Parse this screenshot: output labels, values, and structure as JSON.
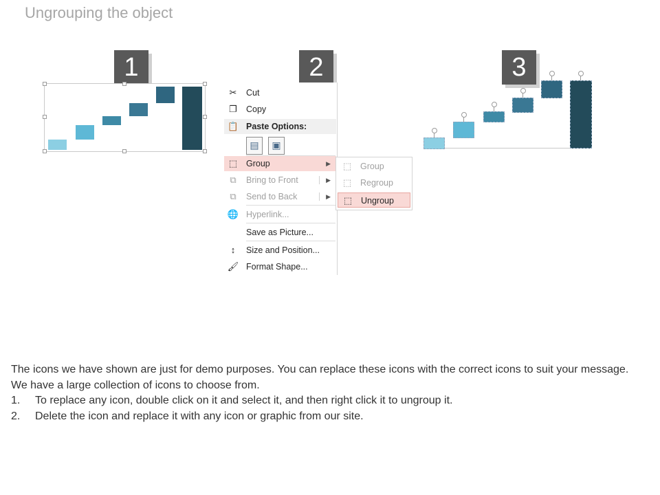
{
  "title": "Ungrouping the object",
  "steps": [
    "1",
    "2",
    "3"
  ],
  "colors": {
    "bar_light": "#8ccfe3",
    "bar_mid": "#5eb8d6",
    "bar_teal": "#3e7f98",
    "bar_dark": "#2c5d72",
    "bar_darkest": "#234b5a",
    "menu_hover": "#f9d9d6"
  },
  "context_menu": {
    "items": [
      {
        "label": "Cut",
        "icon": "scissors-icon",
        "enabled": true
      },
      {
        "label": "Copy",
        "icon": "copy-icon",
        "enabled": true
      },
      {
        "label": "Paste Options:",
        "icon": "paste-icon",
        "header": true
      },
      {
        "label": "Group",
        "icon": "group-icon",
        "enabled": true,
        "submenu": true,
        "highlighted": true
      },
      {
        "label": "Bring to Front",
        "icon": "bring-to-front-icon",
        "enabled": false,
        "submenu": true
      },
      {
        "label": "Send to Back",
        "icon": "send-to-back-icon",
        "enabled": false,
        "submenu": true
      },
      {
        "label": "Hyperlink...",
        "icon": "hyperlink-icon",
        "enabled": false
      },
      {
        "label": "Save as Picture...",
        "icon": "",
        "enabled": true
      },
      {
        "label": "Size and Position...",
        "icon": "size-position-icon",
        "enabled": true
      },
      {
        "label": "Format Shape...",
        "icon": "format-shape-icon",
        "enabled": true
      }
    ]
  },
  "submenu": {
    "items": [
      {
        "label": "Group",
        "icon": "group-icon",
        "enabled": false
      },
      {
        "label": "Regroup",
        "icon": "regroup-icon",
        "enabled": false
      },
      {
        "label": "Ungroup",
        "icon": "ungroup-icon",
        "enabled": true,
        "highlighted": true
      }
    ]
  },
  "body": {
    "intro": "The icons we have shown are just for demo purposes. You can replace these icons with the correct icons to suit your message. We have a large collection of icons to choose from.",
    "list": [
      {
        "num": "1.",
        "text": "To replace any icon, double click on it and select it, and then right click it to ungroup it."
      },
      {
        "num": "2.",
        "text": "Delete the icon and replace it with any icon or graphic from our site."
      }
    ]
  }
}
